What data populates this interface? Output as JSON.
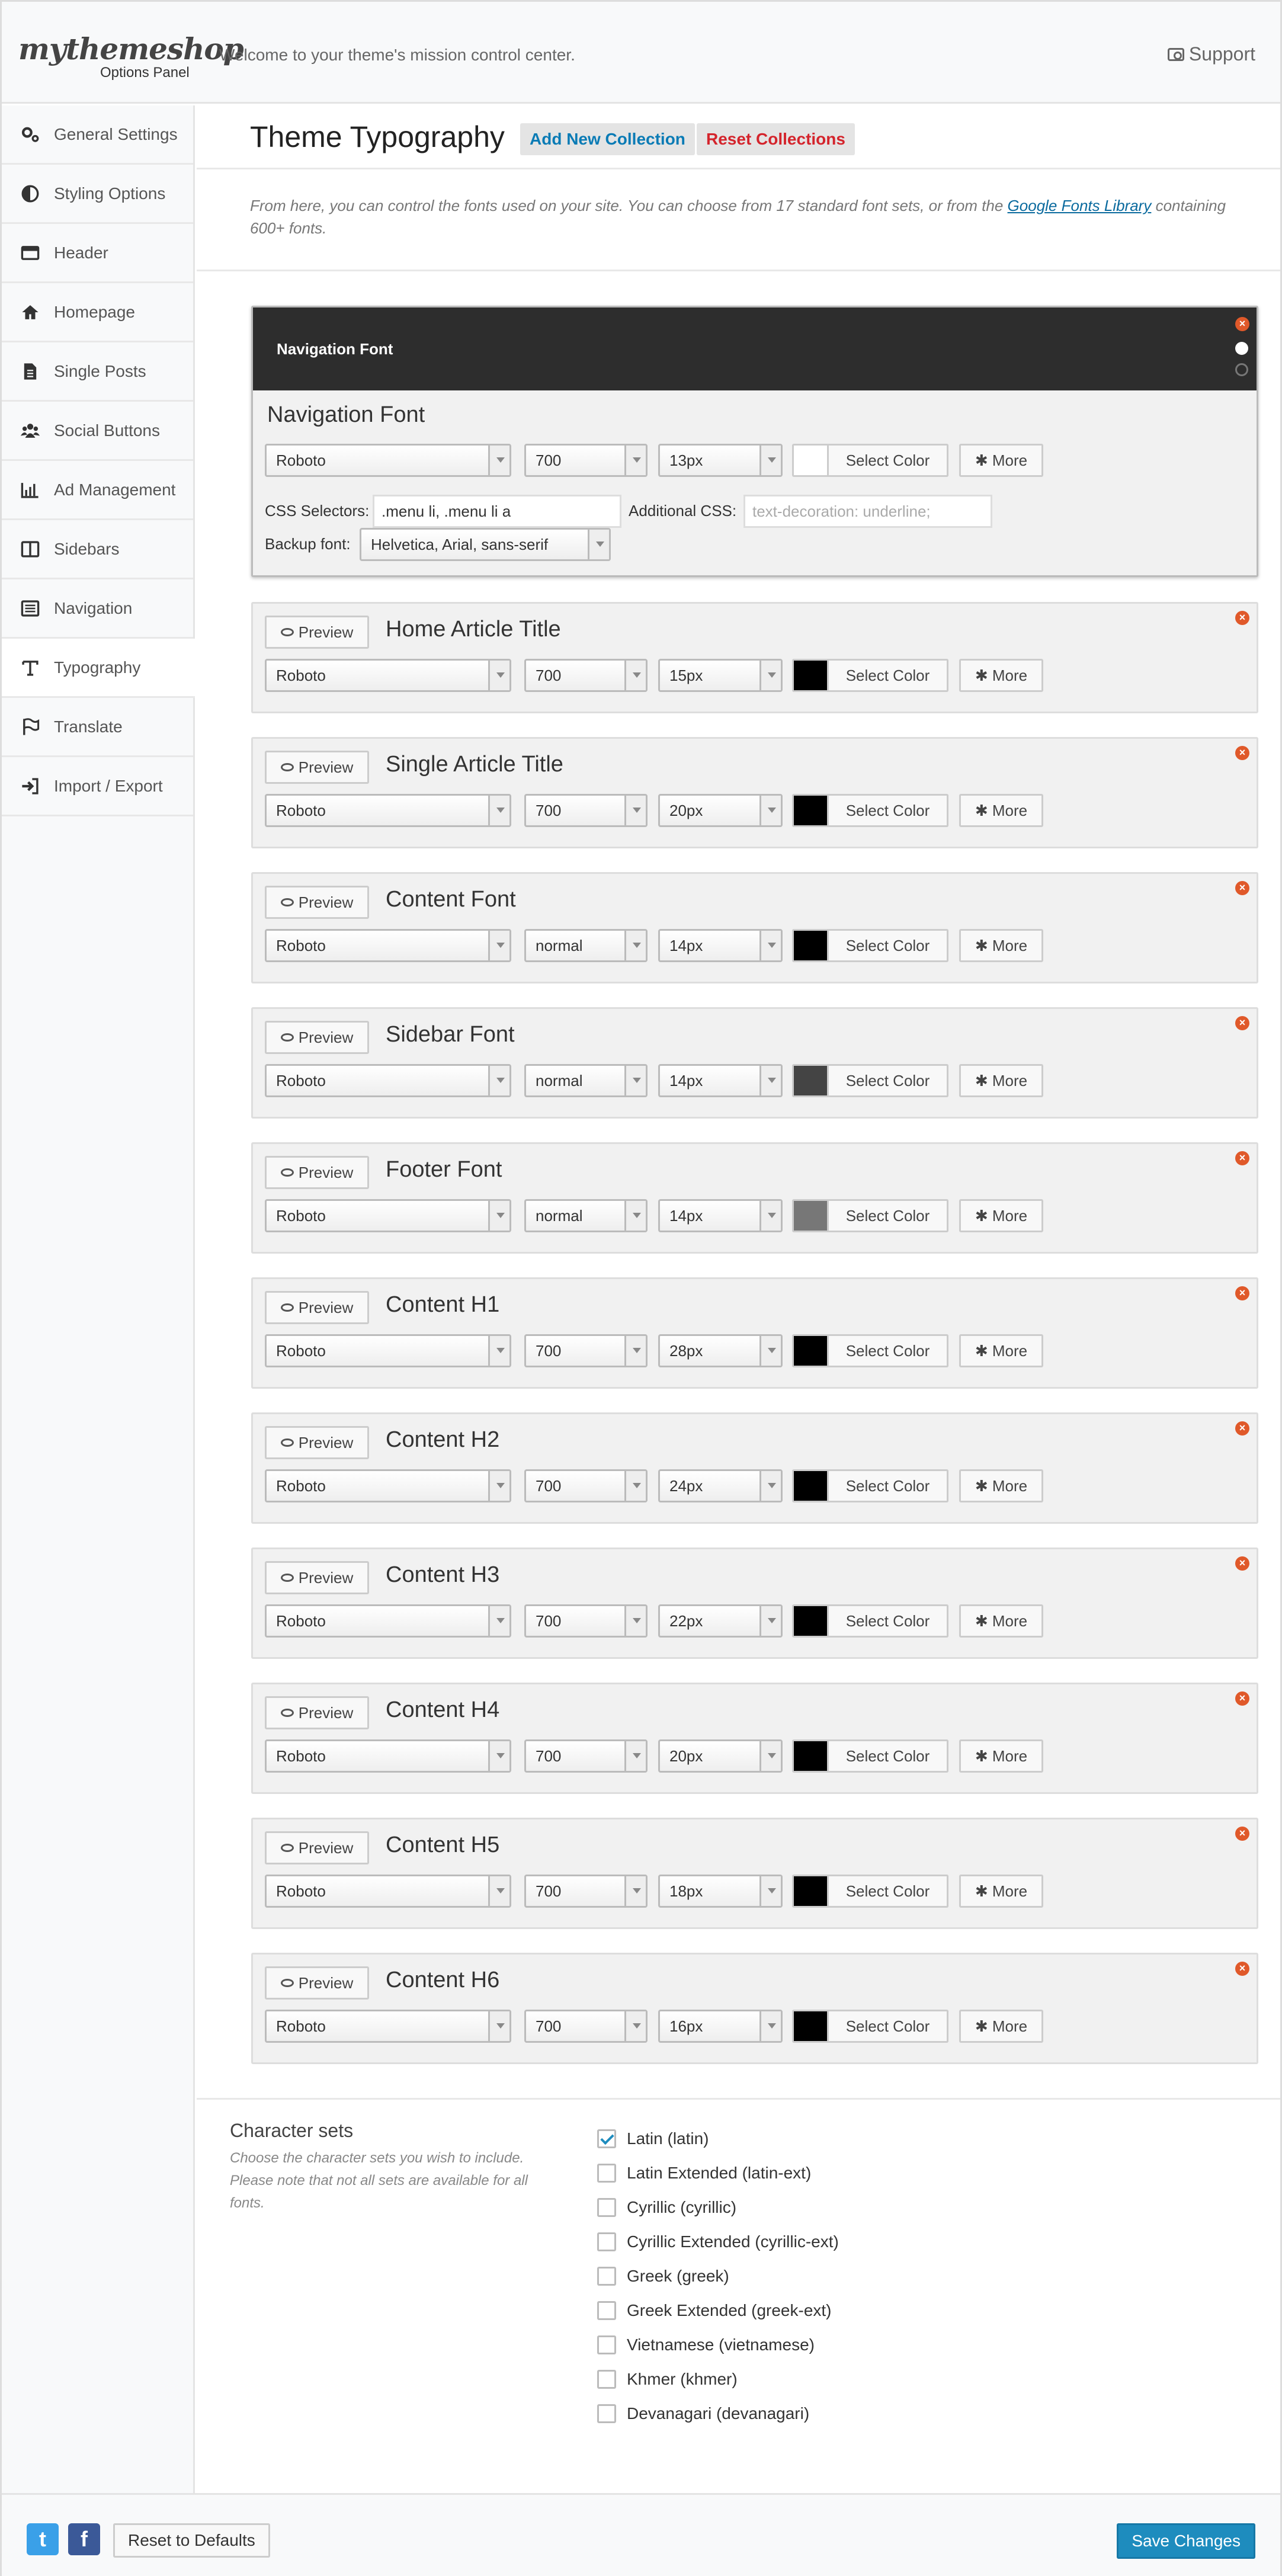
{
  "header": {
    "logo": "mythemeshop",
    "logo_sub": "Options Panel",
    "welcome": "Welcome to your theme's mission control center.",
    "support": "Support"
  },
  "sidebar": {
    "items": [
      {
        "label": "General Settings",
        "icon": "gears-icon"
      },
      {
        "label": "Styling Options",
        "icon": "contrast-icon"
      },
      {
        "label": "Header",
        "icon": "header-icon"
      },
      {
        "label": "Homepage",
        "icon": "home-icon"
      },
      {
        "label": "Single Posts",
        "icon": "document-icon"
      },
      {
        "label": "Social Buttons",
        "icon": "users-icon"
      },
      {
        "label": "Ad Management",
        "icon": "bar-chart-icon"
      },
      {
        "label": "Sidebars",
        "icon": "columns-icon"
      },
      {
        "label": "Navigation",
        "icon": "list-icon"
      },
      {
        "label": "Typography",
        "icon": "typography-icon",
        "active": true
      },
      {
        "label": "Translate",
        "icon": "flag-icon"
      },
      {
        "label": "Import / Export",
        "icon": "sign-in-icon"
      }
    ]
  },
  "main": {
    "title": "Theme Typography",
    "add_collection": "Add New Collection",
    "reset_collections": "Reset Collections",
    "intro_before": "From here, you can control the fonts used on your site. You can choose from 17 standard font sets, or from the ",
    "intro_link": "Google Fonts Library",
    "intro_after": " containing 600+ fonts."
  },
  "labels": {
    "preview": "Preview",
    "select_color": "Select Color",
    "more": "More",
    "css_selectors": "CSS Selectors:",
    "additional_css": "Additional CSS:",
    "backup_font": "Backup font:"
  },
  "nav_font": {
    "preview_text": "Navigation Font",
    "title": "Navigation Font",
    "family": "Roboto",
    "weight": "700",
    "size": "13px",
    "color": "#ffffff",
    "css_selectors": ".menu li, .menu li a",
    "additional_css_placeholder": "text-decoration: underline;",
    "backup_font": "Helvetica, Arial, sans-serif"
  },
  "fonts": [
    {
      "title": "Home Article Title",
      "family": "Roboto",
      "weight": "700",
      "size": "15px",
      "color": "#000000"
    },
    {
      "title": "Single Article Title",
      "family": "Roboto",
      "weight": "700",
      "size": "20px",
      "color": "#000000"
    },
    {
      "title": "Content Font",
      "family": "Roboto",
      "weight": "normal",
      "size": "14px",
      "color": "#000000"
    },
    {
      "title": "Sidebar Font",
      "family": "Roboto",
      "weight": "normal",
      "size": "14px",
      "color": "#444444"
    },
    {
      "title": "Footer Font",
      "family": "Roboto",
      "weight": "normal",
      "size": "14px",
      "color": "#777777"
    },
    {
      "title": "Content H1",
      "family": "Roboto",
      "weight": "700",
      "size": "28px",
      "color": "#000000"
    },
    {
      "title": "Content H2",
      "family": "Roboto",
      "weight": "700",
      "size": "24px",
      "color": "#000000"
    },
    {
      "title": "Content H3",
      "family": "Roboto",
      "weight": "700",
      "size": "22px",
      "color": "#000000"
    },
    {
      "title": "Content H4",
      "family": "Roboto",
      "weight": "700",
      "size": "20px",
      "color": "#000000"
    },
    {
      "title": "Content H5",
      "family": "Roboto",
      "weight": "700",
      "size": "18px",
      "color": "#000000"
    },
    {
      "title": "Content H6",
      "family": "Roboto",
      "weight": "700",
      "size": "16px",
      "color": "#000000"
    }
  ],
  "charsets": {
    "title": "Character sets",
    "description": "Choose the character sets you wish to include. Please note that not all sets are available for all fonts.",
    "items": [
      {
        "label": "Latin (latin)",
        "checked": true
      },
      {
        "label": "Latin Extended (latin-ext)",
        "checked": false
      },
      {
        "label": "Cyrillic (cyrillic)",
        "checked": false
      },
      {
        "label": "Cyrillic Extended (cyrillic-ext)",
        "checked": false
      },
      {
        "label": "Greek (greek)",
        "checked": false
      },
      {
        "label": "Greek Extended (greek-ext)",
        "checked": false
      },
      {
        "label": "Vietnamese (vietnamese)",
        "checked": false
      },
      {
        "label": "Khmer (khmer)",
        "checked": false
      },
      {
        "label": "Devanagari (devanagari)",
        "checked": false
      }
    ]
  },
  "footer": {
    "twitter_glyph": "t",
    "facebook_glyph": "f",
    "reset_defaults": "Reset to Defaults",
    "save_changes": "Save Changes"
  },
  "colors": {
    "accent": "#1e8cbe",
    "link": "#0a7bb5",
    "danger": "#d4242c",
    "close": "#e0592a",
    "twitter": "#3aa0e8",
    "facebook": "#3b5998"
  }
}
